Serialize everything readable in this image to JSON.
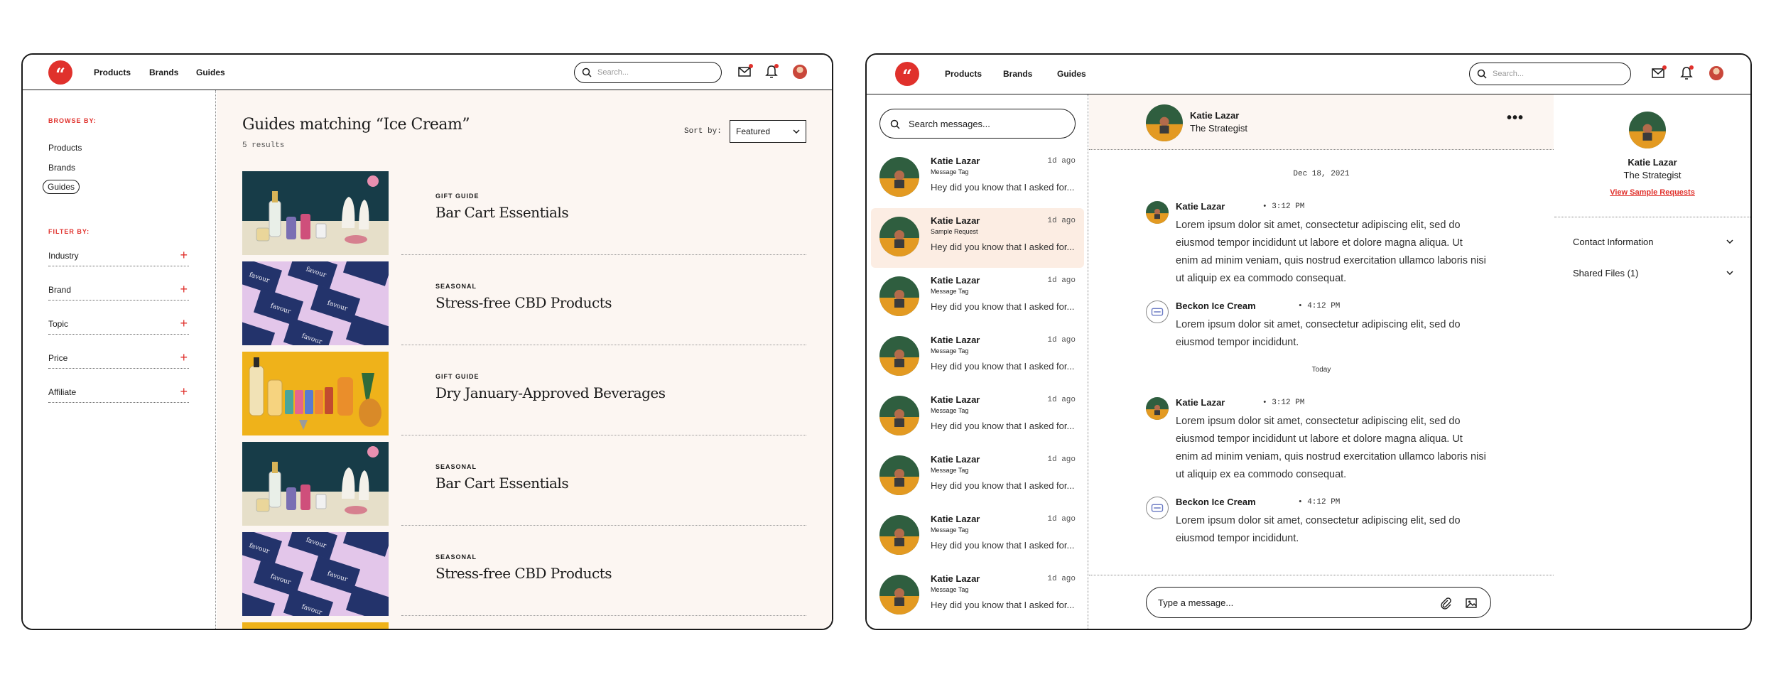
{
  "colors": {
    "accent": "#e0312c",
    "cream": "#fcf6f2",
    "selected": "#fcede3"
  },
  "left": {
    "nav": {
      "logo_glyph": "“",
      "links": [
        "Products",
        "Brands",
        "Guides"
      ],
      "search_placeholder": "Search..."
    },
    "sidebar": {
      "browse_heading": "BROWSE BY:",
      "browse": [
        "Products",
        "Brands",
        "Guides"
      ],
      "filter_heading": "FILTER BY:",
      "filters": [
        "Industry",
        "Brand",
        "Topic",
        "Price",
        "Affiliate"
      ],
      "plus": "+"
    },
    "main": {
      "title": "Guides matching “Ice Cream”",
      "count": "5 results",
      "sort_label": "Sort by:",
      "sort_value": "Featured",
      "guides": [
        {
          "tag": "GIFT GUIDE",
          "title": "Bar Cart Essentials",
          "image": "bar-cart"
        },
        {
          "tag": "SEASONAL",
          "title": "Stress-free CBD Products",
          "image": "cbd"
        },
        {
          "tag": "GIFT GUIDE",
          "title": "Dry January-Approved Beverages",
          "image": "beverages"
        },
        {
          "tag": "SEASONAL",
          "title": "Bar Cart Essentials",
          "image": "bar-cart"
        },
        {
          "tag": "SEASONAL",
          "title": "Stress-free CBD Products",
          "image": "cbd"
        }
      ]
    }
  },
  "right": {
    "nav": {
      "logo_glyph": "“",
      "links": [
        "Products",
        "Brands",
        "Guides"
      ],
      "search_placeholder": "Search..."
    },
    "inbox": {
      "search_placeholder": "Search messages...",
      "items": [
        {
          "name": "Katie Lazar",
          "time": "1d ago",
          "tag": "Message Tag",
          "preview": "Hey did you know that I asked for...",
          "selected": false
        },
        {
          "name": "Katie Lazar",
          "time": "1d ago",
          "tag": "Sample Request",
          "preview": "Hey did you know that I asked for...",
          "selected": true
        },
        {
          "name": "Katie Lazar",
          "time": "1d ago",
          "tag": "Message Tag",
          "preview": "Hey did you know that I asked for...",
          "selected": false
        },
        {
          "name": "Katie Lazar",
          "time": "1d ago",
          "tag": "Message Tag",
          "preview": "Hey did you know that I asked for...",
          "selected": false
        },
        {
          "name": "Katie Lazar",
          "time": "1d ago",
          "tag": "Message Tag",
          "preview": "Hey did you know that I asked for...",
          "selected": false
        },
        {
          "name": "Katie Lazar",
          "time": "1d ago",
          "tag": "Message Tag",
          "preview": "Hey did you know that I asked for...",
          "selected": false
        },
        {
          "name": "Katie Lazar",
          "time": "1d ago",
          "tag": "Message Tag",
          "preview": "Hey did you know that I asked for...",
          "selected": false
        },
        {
          "name": "Katie Lazar",
          "time": "1d ago",
          "tag": "Message Tag",
          "preview": "Hey did you know that I asked for...",
          "selected": false
        },
        {
          "name": "Katie Lazar",
          "time": "1d ago",
          "tag": "",
          "preview": "",
          "selected": false
        }
      ]
    },
    "conversation": {
      "header": {
        "name": "Katie Lazar",
        "subtitle": "The Strategist",
        "more": "•••"
      },
      "sep1": "Dec 18, 2021",
      "sep2": "Today",
      "messages": [
        {
          "sender": "Katie Lazar",
          "time": "• 3:12 PM",
          "brand": false,
          "body": "Lorem ipsum dolor sit amet, consectetur adipiscing elit, sed do eiusmod tempor incididunt ut labore et dolore magna aliqua. Ut enim ad minim veniam, quis nostrud exercitation ullamco laboris nisi ut aliquip ex ea commodo consequat."
        },
        {
          "sender": "Beckon Ice Cream",
          "time": "• 4:12 PM",
          "brand": true,
          "body": "Lorem ipsum dolor sit amet, consectetur adipiscing elit, sed do eiusmod tempor incididunt."
        },
        {
          "sender": "Katie Lazar",
          "time": "• 3:12 PM",
          "brand": false,
          "body": "Lorem ipsum dolor sit amet, consectetur adipiscing elit, sed do eiusmod tempor incididunt ut labore et dolore magna aliqua. Ut enim ad minim veniam, quis nostrud exercitation ullamco laboris nisi ut aliquip ex ea commodo consequat."
        },
        {
          "sender": "Beckon Ice Cream",
          "time": "• 4:12 PM",
          "brand": true,
          "body": "Lorem ipsum dolor sit amet, consectetur adipiscing elit, sed do eiusmod tempor incididunt."
        }
      ],
      "composer_placeholder": "Type a message..."
    },
    "profile": {
      "name": "Katie Lazar",
      "subtitle": "The Strategist",
      "link": "View Sample Requests",
      "sections": [
        "Contact Information",
        "Shared Files (1)"
      ]
    }
  }
}
